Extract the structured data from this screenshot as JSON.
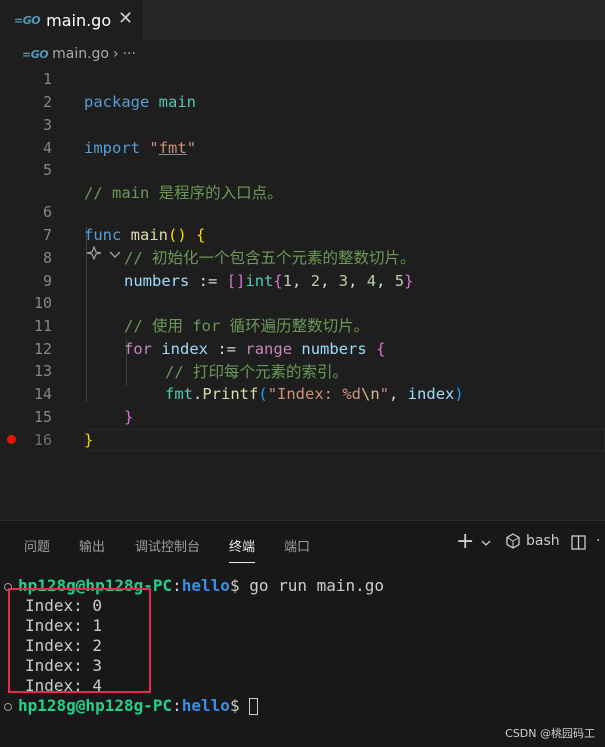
{
  "tab": {
    "title": "main.go",
    "close": "✕"
  },
  "breadcrumb": {
    "file": "main.go",
    "sep": "›",
    "more": "···"
  },
  "code_lines": [
    "1",
    "2",
    "3",
    "4",
    "5",
    "6",
    "7",
    "8",
    "9",
    "10",
    "11",
    "12",
    "13",
    "14",
    "15",
    "16"
  ],
  "code": {
    "l1_kw": "package",
    "l1_name": "main",
    "l3_kw": "import",
    "l3_str": "fmt",
    "l5_comment": "// main 是程序的入口点。",
    "l6_kw": "func",
    "l6_name": "main",
    "l7_comment": "// 初始化一个包含五个元素的整数切片。",
    "l8_var": "numbers",
    "l8_op": ":=",
    "l8_type": "int",
    "l8_vals": [
      "1",
      "2",
      "3",
      "4",
      "5"
    ],
    "l10_comment": "// 使用 for 循环遍历整数切片。",
    "l11_for": "for",
    "l11_var": "index",
    "l11_op": ":=",
    "l11_range": "range",
    "l11_src": "numbers",
    "l12_comment": "// 打印每个元素的索引。",
    "l13_pkg": "fmt",
    "l13_func": "Printf",
    "l13_str": "\"Index: %d",
    "l13_esc": "\\n",
    "l13_end": "\"",
    "l13_arg": "index"
  },
  "panel": {
    "tabs": [
      "问题",
      "输出",
      "调试控制台",
      "终端",
      "端口"
    ],
    "active_tab": "终端",
    "shell": "bash"
  },
  "terminal": {
    "user": "hp128g@hp128g-PC",
    "dir": "hello",
    "command": "go run main.go",
    "output": [
      "Index: 0",
      "Index: 1",
      "Index: 2",
      "Index: 3",
      "Index: 4"
    ]
  },
  "watermark": "CSDN @桃园码工",
  "colors": {
    "keyword": "#569cd6",
    "comment": "#6a9955",
    "string": "#ce9178",
    "user": "#23d18b",
    "dir": "#3b8eea",
    "highlight_box": "#e52b50",
    "breakpoint": "#e51400"
  }
}
